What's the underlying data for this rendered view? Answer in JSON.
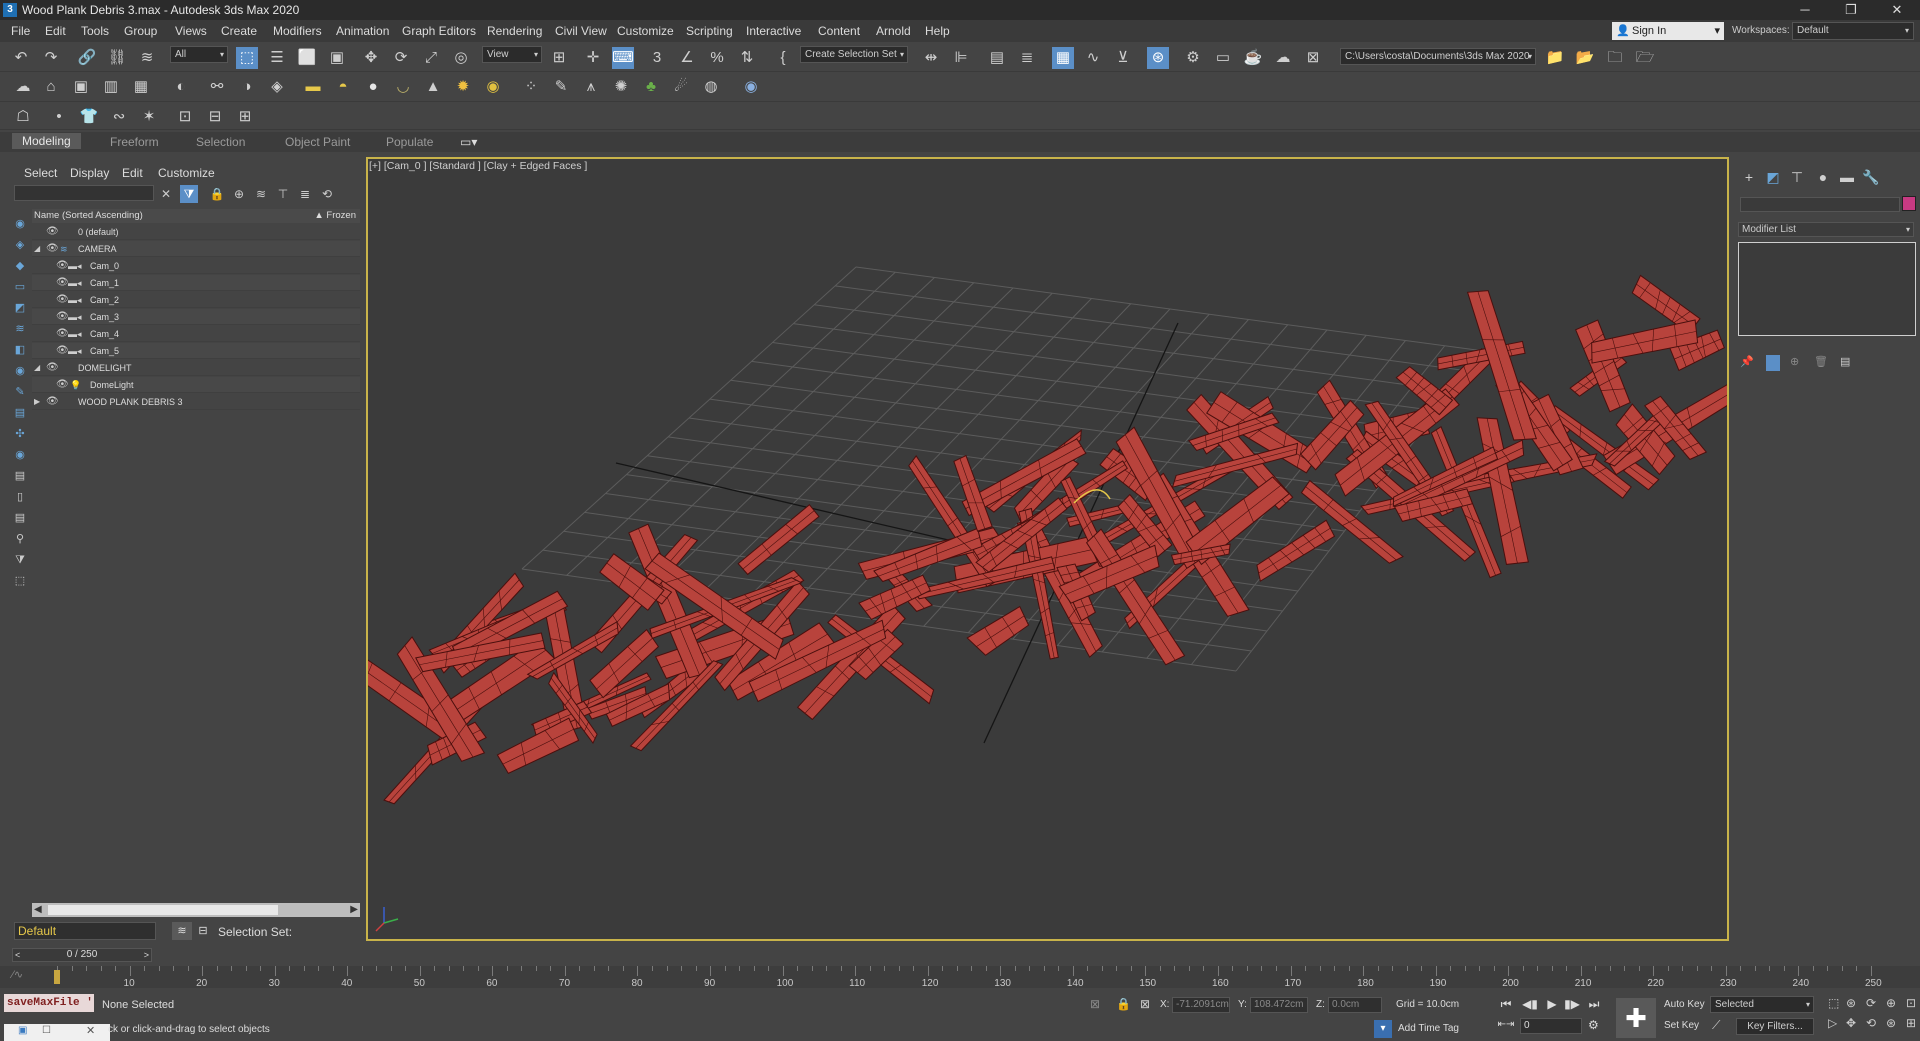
{
  "window": {
    "title": "Wood Plank Debris 3.max - Autodesk 3ds Max 2020",
    "app_icon": "3"
  },
  "menu": [
    "File",
    "Edit",
    "Tools",
    "Group",
    "Views",
    "Create",
    "Modifiers",
    "Animation",
    "Graph Editors",
    "Rendering",
    "Civil View",
    "Customize",
    "Scripting",
    "Interactive",
    "Content",
    "Arnold",
    "Help"
  ],
  "account": {
    "sign_in": "Sign In",
    "workspaces_label": "Workspaces:",
    "workspace": "Default"
  },
  "main_toolbar": {
    "filter": "All",
    "ref_coord": "View",
    "selection_set": "Create Selection Set",
    "project_path": "C:\\Users\\costa\\Documents\\3ds Max 2020"
  },
  "ribbon": {
    "tabs": [
      "Modeling",
      "Freeform",
      "Selection",
      "Object Paint",
      "Populate"
    ],
    "active": "Modeling"
  },
  "scene_explorer": {
    "menu": [
      "Select",
      "Display",
      "Edit",
      "Customize"
    ],
    "header": {
      "name": "Name (Sorted Ascending)",
      "frozen": "▲ Frozen"
    },
    "rows": [
      {
        "label": "0 (default)",
        "kind": "layer"
      },
      {
        "label": "CAMERA",
        "kind": "layer"
      },
      {
        "label": "Cam_0",
        "kind": "camera"
      },
      {
        "label": "Cam_1",
        "kind": "camera"
      },
      {
        "label": "Cam_2",
        "kind": "camera"
      },
      {
        "label": "Cam_3",
        "kind": "camera"
      },
      {
        "label": "Cam_4",
        "kind": "camera"
      },
      {
        "label": "Cam_5",
        "kind": "camera"
      },
      {
        "label": "DOMELIGHT",
        "kind": "layer"
      },
      {
        "label": "DomeLight",
        "kind": "light"
      },
      {
        "label": "WOOD PLANK DEBRIS 3",
        "kind": "layer"
      }
    ],
    "layer_field": "Default",
    "selection_set_label": "Selection Set:"
  },
  "viewport": {
    "label": "[+] [Cam_0 ] [Standard ] [Clay + Edged Faces ]",
    "mesh_color": "#b8433c",
    "wire_color": "#4a0f0d"
  },
  "command_panel": {
    "modifier_list": "Modifier List",
    "object_color": "#c73a82"
  },
  "timeline": {
    "frame": "0 / 250",
    "ticks": [
      "0",
      "10",
      "20",
      "30",
      "40",
      "50",
      "60",
      "70",
      "80",
      "90",
      "100",
      "110",
      "120",
      "130",
      "140",
      "150",
      "160",
      "170",
      "180",
      "190",
      "200",
      "210",
      "220",
      "230",
      "240",
      "250"
    ]
  },
  "status": {
    "maxscript": "saveMaxFile '",
    "selection": "None Selected",
    "prompt": "ck or click-and-drag to select objects",
    "x_label": "X:",
    "x_value": "-71.2091cm",
    "y_label": "Y:",
    "y_value": "108.472cm",
    "z_label": "Z:",
    "z_value": "0.0cm",
    "grid": "Grid = 10.0cm",
    "add_time_tag": "Add Time Tag",
    "auto_key": "Auto Key",
    "set_key": "Set Key",
    "key_mode": "Selected",
    "key_filters": "Key Filters...",
    "current_frame": "0"
  }
}
